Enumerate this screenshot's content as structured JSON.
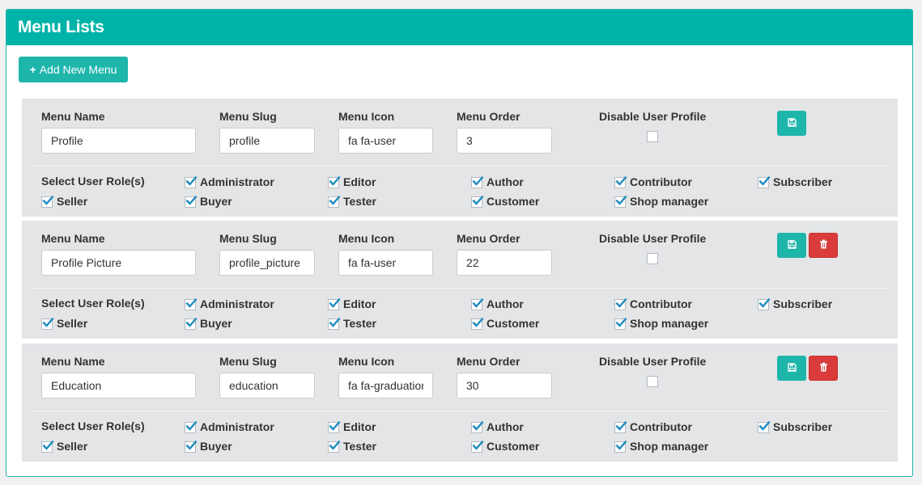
{
  "panel": {
    "title": "Menu Lists",
    "add_button": "Add New Menu"
  },
  "labels": {
    "menu_name": "Menu Name",
    "menu_slug": "Menu Slug",
    "menu_icon": "Menu Icon",
    "menu_order": "Menu Order",
    "disable_user_profile": "Disable User Profile",
    "select_user_roles": "Select User Role(s)"
  },
  "roles": [
    "Administrator",
    "Editor",
    "Author",
    "Contributor",
    "Subscriber",
    "Seller",
    "Buyer",
    "Tester",
    "Customer",
    "Shop manager"
  ],
  "menus": [
    {
      "name": "Profile",
      "slug": "profile",
      "icon": "fa fa-user",
      "order": "3",
      "disable_profile": false,
      "show_delete": false,
      "roles_checked": [
        true,
        true,
        true,
        true,
        true,
        true,
        true,
        true,
        true,
        true
      ]
    },
    {
      "name": "Profile Picture",
      "slug": "profile_picture",
      "icon": "fa fa-user",
      "order": "22",
      "disable_profile": false,
      "show_delete": true,
      "roles_checked": [
        true,
        true,
        true,
        true,
        true,
        true,
        true,
        true,
        true,
        true
      ]
    },
    {
      "name": "Education",
      "slug": "education",
      "icon": "fa fa-graduation-cap",
      "order": "30",
      "disable_profile": false,
      "show_delete": true,
      "roles_checked": [
        true,
        true,
        true,
        true,
        true,
        true,
        true,
        true,
        true,
        true
      ]
    }
  ],
  "icons": {
    "save": "floppy-disk-icon",
    "delete": "trash-icon",
    "add": "plus-icon",
    "check": "checkmark-icon"
  },
  "colors": {
    "header": "#00b3a8",
    "save_button": "#1eb5ab",
    "delete_button": "#da3c3c",
    "row_background": "#e4e5e7",
    "checkmark": "#1e8cbe"
  }
}
